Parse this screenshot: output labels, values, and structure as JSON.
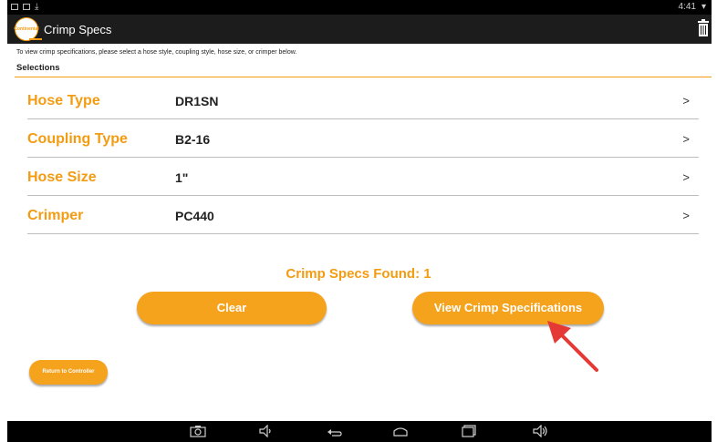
{
  "status_bar": {
    "time": "4:41"
  },
  "app_bar": {
    "title": "Crimp Specs",
    "logo_text": "Continental"
  },
  "instructions": "To view crimp specifications, please select a hose style, coupling style, hose size, or crimper below.",
  "section_title": "Selections",
  "selections": [
    {
      "label": "Hose Type",
      "value": "DR1SN"
    },
    {
      "label": "Coupling Type",
      "value": "B2-16"
    },
    {
      "label": "Hose Size",
      "value": "1\""
    },
    {
      "label": "Crimper",
      "value": "PC440"
    }
  ],
  "found_text": "Crimp Specs Found: 1",
  "buttons": {
    "clear": "Clear",
    "view": "View Crimp Specifications",
    "return": "Return to Controller"
  },
  "icons": {
    "chevron": "chevron-right-icon",
    "trash": "trash-icon"
  },
  "colors": {
    "accent": "#f39c12",
    "button": "#f5a21d",
    "arrow": "#e53935"
  }
}
